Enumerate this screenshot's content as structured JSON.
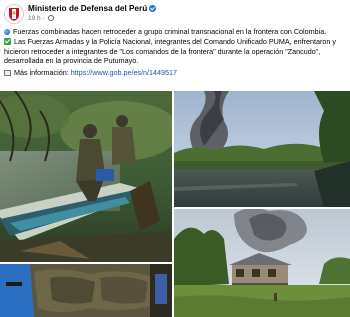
{
  "post": {
    "author": "Ministerio de Defensa del Perú",
    "time": "19 h",
    "line1": "Fuerzas combinadas hacen retroceder a grupo criminal transnacional en la frontera con Colombia.",
    "line2": "Las Fuerzas Armadas y la Policía Nacional, integrantes del Comando Unificado PUMA, enfrentaron y hicieron retroceder a integrantes de \"Los comandos de la frontera\" durante la operación \"Zancudo\", desarrollada en la provincia de Putumayo.",
    "more_label": "Más información:",
    "link": "https://www.gob.pe/es/n/1449517",
    "icons": [
      "globe-emoji-icon",
      "check-mark-emoji-icon",
      "link-emoji-icon",
      "verified-badge-icon",
      "public-audience-icon"
    ]
  },
  "photos": [
    {
      "name": "photo-soldiers-boat"
    },
    {
      "name": "photo-river-smoke"
    },
    {
      "name": "photo-house-smoke"
    },
    {
      "name": "photo-seized-equipment"
    }
  ],
  "colors": {
    "link": "#1b55b3",
    "verified": "#1b74e4",
    "meta": "#65676b"
  }
}
